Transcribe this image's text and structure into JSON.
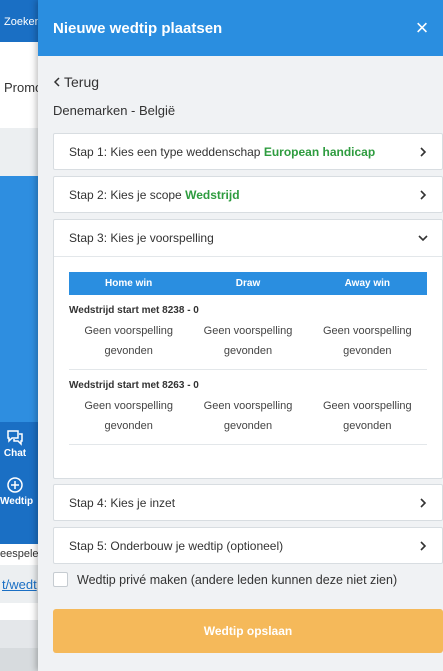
{
  "background": {
    "topbar_text": "Zoeken",
    "promo_text": "Promo",
    "nav_chat_label": "Chat",
    "nav_wedtip_label": "Wedtip",
    "speler_text": "eespele",
    "link_text": "t/wedt"
  },
  "panel": {
    "title": "Nieuwe wedtip plaatsen",
    "close_symbol": "×",
    "back_label": "Terug",
    "match_title": "Denemarken - België"
  },
  "steps": [
    {
      "label": "Stap 1: Kies een type weddenschap ",
      "value": "European handicap"
    },
    {
      "label": "Stap 2: Kies je scope ",
      "value": "Wedstrijd"
    },
    {
      "label": "Stap 3: Kies je voorspelling",
      "value": ""
    },
    {
      "label": "Stap 4: Kies je inzet",
      "value": ""
    },
    {
      "label": "Stap 5: Onderbouw je wedtip (optioneel)",
      "value": ""
    }
  ],
  "prediction_table": {
    "headers": [
      "Home win",
      "Draw",
      "Away win"
    ],
    "matches": [
      {
        "label": "Wedstrijd start met 8238 - 0",
        "cells": [
          "Geen voorspelling gevonden",
          "Geen voorspelling gevonden",
          "Geen voorspelling gevonden"
        ]
      },
      {
        "label": "Wedstrijd start met 8263 - 0",
        "cells": [
          "Geen voorspelling gevonden",
          "Geen voorspelling gevonden",
          "Geen voorspelling gevonden"
        ]
      }
    ]
  },
  "private_checkbox_label": "Wedtip privé maken (andere leden kunnen deze niet zien)",
  "save_button_label": "Wedtip opslaan",
  "colors": {
    "header_blue": "#2a8ee0",
    "accent_green": "#2e9c3f",
    "save_orange": "#f5b95a"
  }
}
